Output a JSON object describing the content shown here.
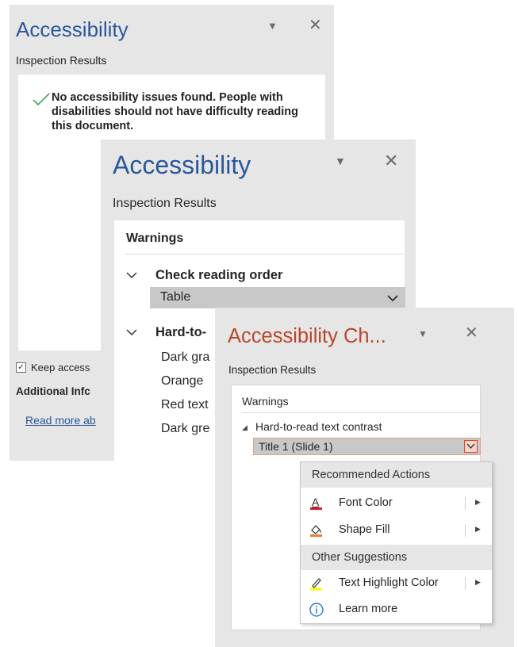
{
  "word_pane": {
    "title": "Accessibility",
    "subheading": "Inspection Results",
    "message": "No accessibility issues found. People with disabilities should not have difficulty reading this document.",
    "keep_checkbox_label": "Keep access",
    "additional_info": "Additional Infc",
    "read_more_link": "Read more ab"
  },
  "excel_pane": {
    "title": "Accessibility",
    "subheading": "Inspection Results",
    "warnings_label": "Warnings",
    "group1": {
      "title": "Check reading order",
      "selected_item": "Table"
    },
    "group2": {
      "title": "Hard-to-",
      "items": [
        "Dark gra",
        "Orange",
        "Red text",
        "Dark gre"
      ]
    }
  },
  "ppt_pane": {
    "title": "Accessibility Ch...",
    "subheading": "Inspection Results",
    "warnings_label": "Warnings",
    "category": "Hard-to-read text contrast",
    "selected_item": "Title 1  (Slide 1)"
  },
  "context_menu": {
    "recommended_header": "Recommended Actions",
    "font_color": "Font Color",
    "shape_fill": "Shape Fill",
    "other_header": "Other Suggestions",
    "text_highlight": "Text Highlight Color",
    "learn_more": "Learn more"
  },
  "colors": {
    "word_accent": "#2b579a",
    "ppt_accent": "#b7472a",
    "check_green": "#3aa757",
    "font_color_bar": "#e51c23",
    "shape_fill_bar": "#ed7d31",
    "highlight_bar": "#ffff00",
    "info_blue": "#2b7cd3"
  }
}
